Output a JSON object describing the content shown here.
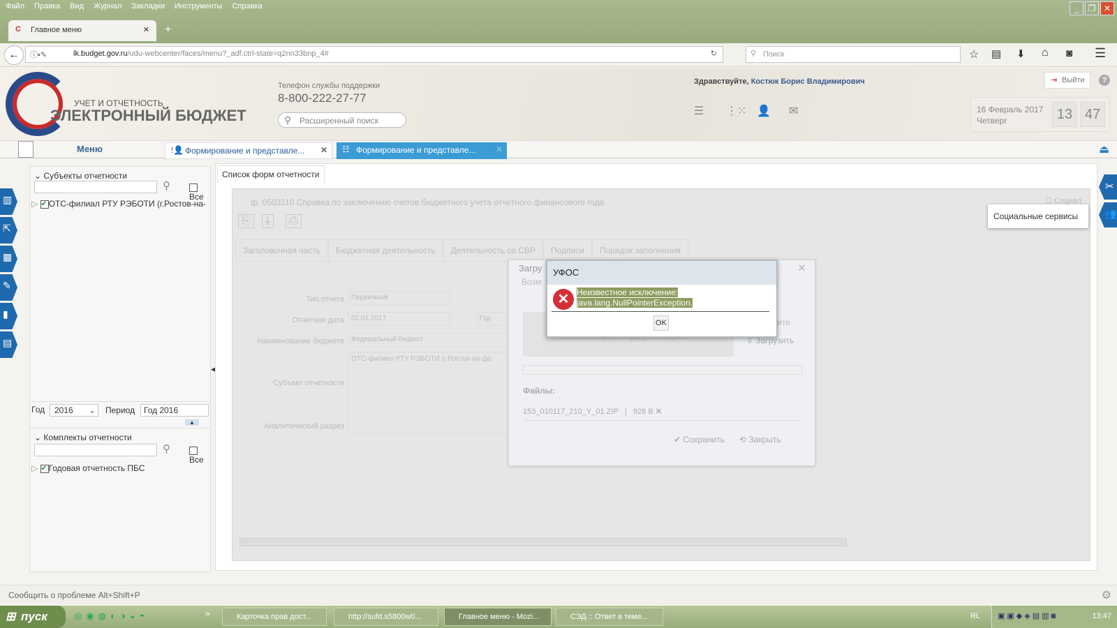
{
  "browser": {
    "menu": [
      "Файл",
      "Правка",
      "Вид",
      "Журнал",
      "Закладки",
      "Инструменты",
      "Справка"
    ],
    "tab_title": "Главное меню",
    "url_host": "lk.budget.gov.ru",
    "url_path": "/udu-webcenter/faces/menu?_adf.ctrl-state=q2nn33bnp_4#",
    "search_placeholder": "Поиск"
  },
  "header": {
    "logo_small": "УЧЕТ И ОТЧЕТНОСТЬ",
    "logo_big": "ЭЛЕКТРОННЫЙ БЮДЖЕТ",
    "support_label": "Телефон службы поддержки",
    "support_phone": "8-800-222-27-77",
    "adv_search_placeholder": "Расширенный поиск",
    "greeting": "Здравствуйте,",
    "user_name": "Костюк Борис Владимирович",
    "logout": "Выйти",
    "date": "16 Февраль 2017",
    "weekday": "Четверг",
    "hour": "13",
    "minute": "47"
  },
  "app_tabs": {
    "menu": "Меню",
    "tab1": "Формирование и представле...",
    "tab2": "Формирование и представле..."
  },
  "left": {
    "subjects_title": "Субъекты отчетности",
    "all_label": "Все",
    "subject_item": "ОТС-филиал РТУ РЭБОТИ (г.Ростов-на-",
    "year_label": "Год",
    "year_value": "2016",
    "period_label": "Период",
    "period_value": "Год 2016",
    "kits_title": "Комплекты отчетности",
    "kit_item": "Годовая отчетность ПБС"
  },
  "main": {
    "tab": "Список форм отчетности",
    "form_title": "ф. 0503110 Справка по заключению счетов бюджетного учета отчетного финансового года",
    "form_tabs": [
      "Заголовочная часть",
      "Бюджетная деятельность",
      "Деятельность со СВР",
      "Подписи",
      "Порядок заполнения"
    ],
    "fields": {
      "type_label": "Тип отчета",
      "type_value": "Первичный",
      "date_label": "Отчетная дата",
      "date_value": "01.01.2017",
      "year_ph": "Год",
      "budget_label": "Наименование бюджета",
      "budget_value": "Федеральный бюджет",
      "subject_label": "Субъект отчетности",
      "subject_value": "ОТС-филиал РТУ РЭБОТИ (г.Ростов-на-До",
      "analytic_label": "Аналитический разрез"
    },
    "social_checkbox": "Социал"
  },
  "upload": {
    "title": "Загру",
    "subtitle": "Возм",
    "drop_hint": "Поместите файл сюда для загрузки",
    "right_hint": "мите",
    "upload_btn": "Загрузить",
    "files_label": "Файлы:",
    "file_name": "153_010117_210_Y_01.ZIP",
    "file_size": "928 B",
    "save": "Сохранить",
    "close": "Закрыть"
  },
  "error": {
    "title": "УФОС",
    "line1": "Неизвестное исключение:",
    "line2": "java.lang.NullPointerException.",
    "ok": "OK"
  },
  "tooltip": "Социальные сервисы",
  "status": "Сообщить о проблеме Alt+Shift+P",
  "taskbar": {
    "start": "пуск",
    "items": [
      "Карточка прав дост...",
      "http://sufd.s5800w0...",
      "Главное меню - Mozi...",
      "СЭД :: Ответ в теме..."
    ],
    "lang": "RL",
    "clock": "13:47"
  },
  "colors": {
    "accent": "#1f6aae",
    "tab_active": "#3a9bd5",
    "error": "#d32f3a",
    "selection": "#8c9c5e"
  }
}
